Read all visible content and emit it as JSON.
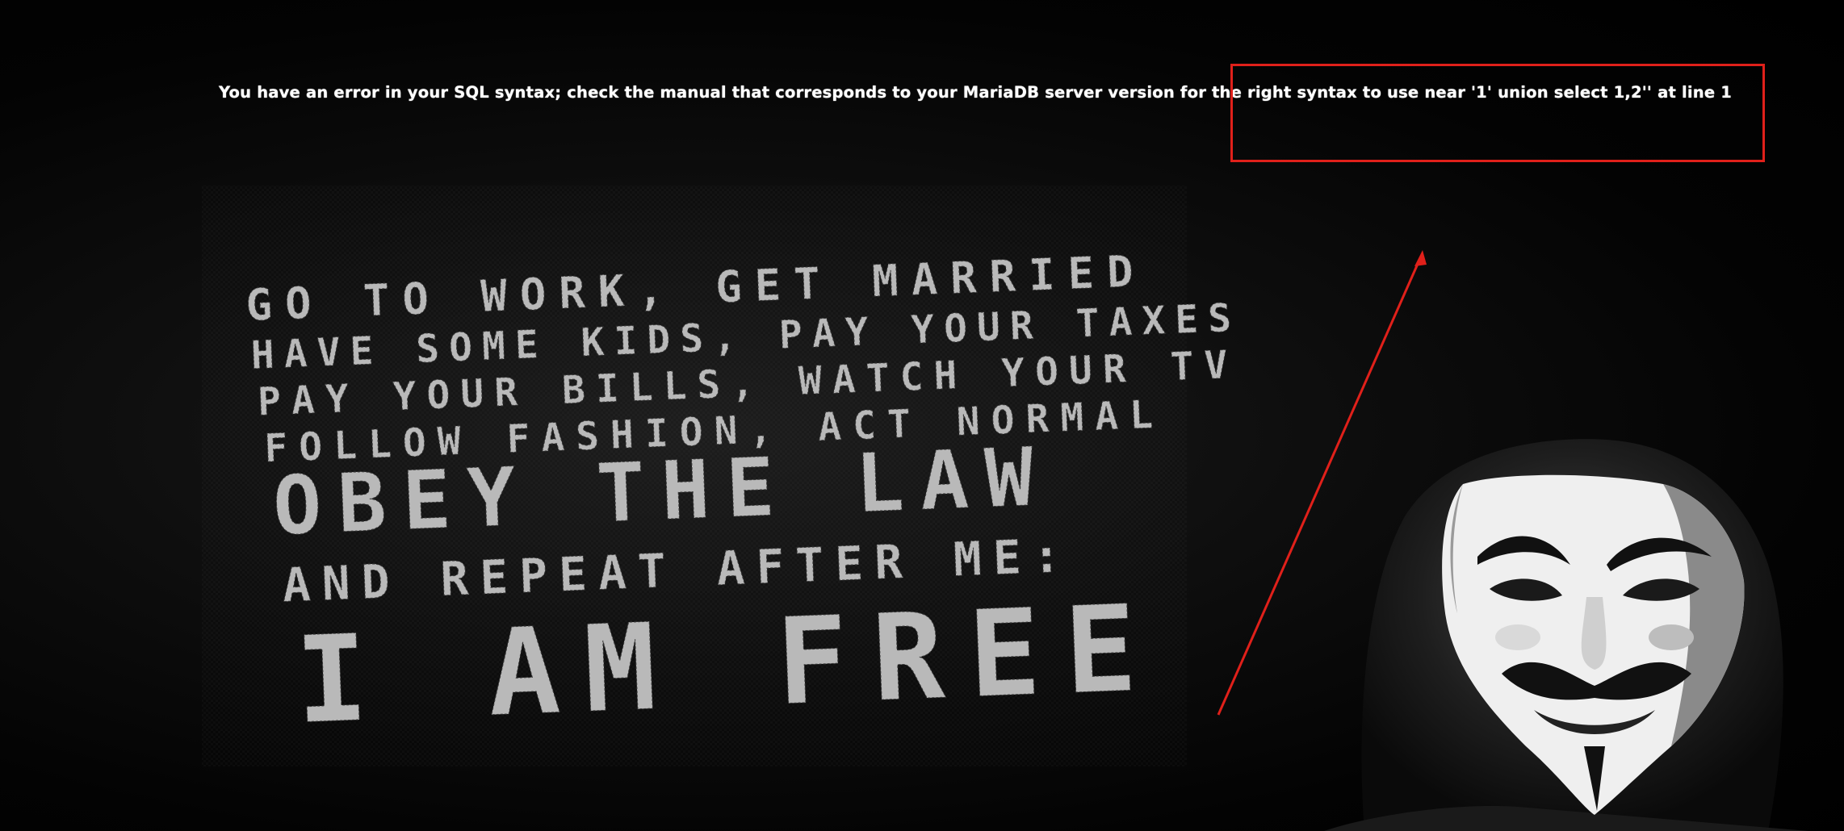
{
  "error": {
    "message": "You have an error in your SQL syntax; check the manual that corresponds to your MariaDB server version for the right syntax to use near '1' union select 1,2'' at line 1"
  },
  "poster": {
    "lines": [
      "GO TO WORK, GET MARRIED",
      "HAVE SOME KIDS, PAY YOUR TAXES",
      "PAY YOUR BILLS, WATCH YOUR TV",
      "FOLLOW FASHION, ACT NORMAL",
      "OBEY THE LAW",
      "AND REPEAT AFTER ME:",
      "I AM FREE"
    ]
  },
  "colors": {
    "background": "#000000",
    "error_text": "#ffffff",
    "annotation": "#e0201a",
    "poster_text": "#b9b9b9"
  },
  "icons": {
    "mask": "guy-fawkes-mask-icon"
  }
}
